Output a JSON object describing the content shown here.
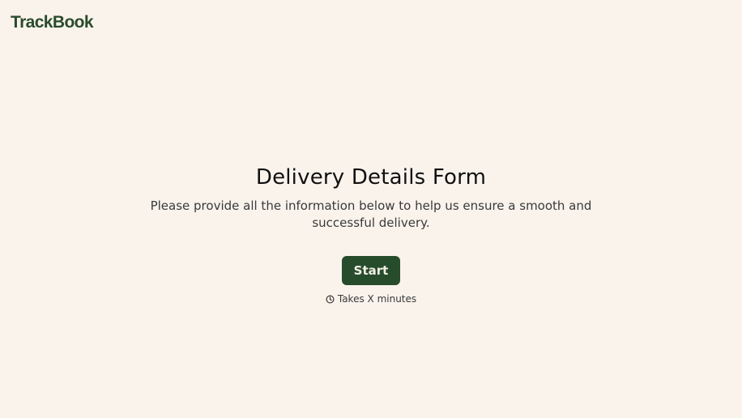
{
  "header": {
    "brand": "TrackBook",
    "brand_color": "#2a4c2c"
  },
  "main": {
    "title": "Delivery Details Form",
    "subtitle": "Please provide all the information below to help us ensure a smooth and successful delivery.",
    "start_label": "Start",
    "start_color": "#264c2c",
    "duration_icon": "clock-icon",
    "duration_text": "Takes X minutes"
  },
  "colors": {
    "background": "#f9f3ec"
  }
}
